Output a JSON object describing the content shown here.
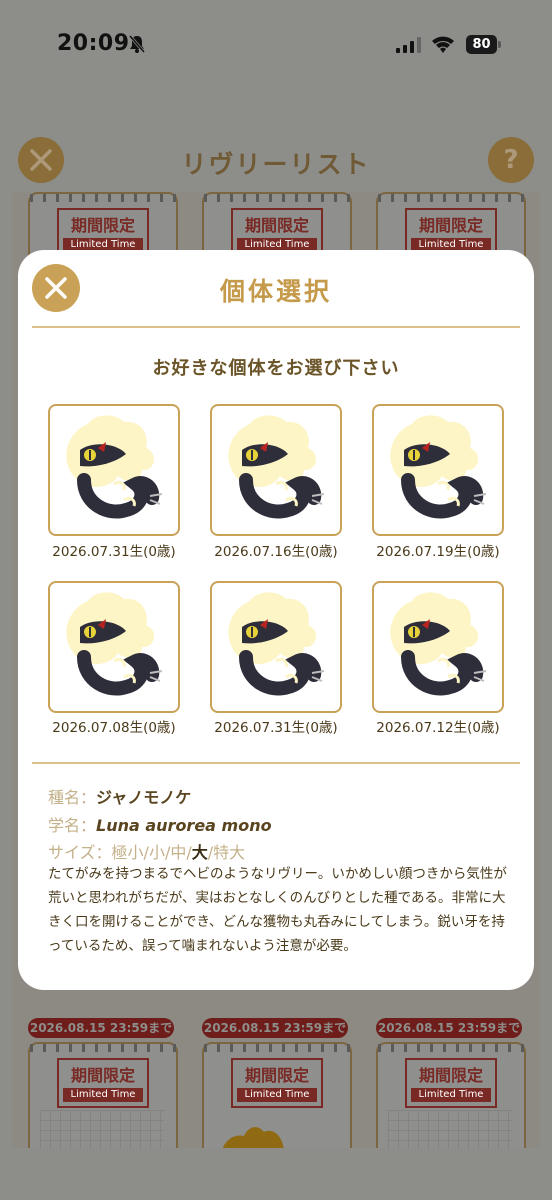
{
  "status": {
    "time": "20:09",
    "battery": "80"
  },
  "background": {
    "title": "リヴリーリスト",
    "help_label": "?",
    "stamp_main": "期間限定",
    "stamp_sub": "Limited Time",
    "deadline": "2026.08.15 23:59まで"
  },
  "modal": {
    "title": "個体選択",
    "prompt": "お好きな個体をお選び下さい",
    "individuals": [
      {
        "label": "2026.07.31生(0歳)"
      },
      {
        "label": "2026.07.16生(0歳)"
      },
      {
        "label": "2026.07.19生(0歳)"
      },
      {
        "label": "2026.07.08生(0歳)"
      },
      {
        "label": "2026.07.31生(0歳)"
      },
      {
        "label": "2026.07.12生(0歳)"
      }
    ],
    "species": {
      "label": "種名：",
      "value": "ジャノモノケ"
    },
    "scientific": {
      "label": "学名：",
      "value": "Luna aurorea mono"
    },
    "size": {
      "label": "サイズ：",
      "options": [
        "極小",
        "小",
        "中",
        "大",
        "特大"
      ],
      "separator": "/",
      "selected": "大"
    },
    "description": "たてがみを持つまるでヘビのようなリヴリー。いかめしい顔つきから気性が荒いと思われがちだが、実はおとなしくのんびりとした種である。非常に大きく口を開けることができ、どんな獲物も丸呑みにしてしまう。鋭い牙を持っているため、誤って噛まれないよう注意が必要。"
  },
  "colors": {
    "accent": "#c9a257",
    "overlay": "#8d8d8a",
    "text_brown": "#6b5428",
    "deadline_red": "#c0392b"
  }
}
